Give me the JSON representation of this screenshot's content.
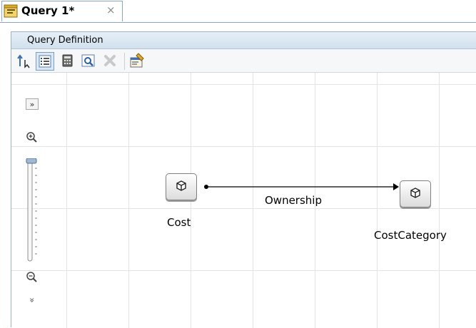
{
  "tab": {
    "title": "Query  1*",
    "close_glyph": "×"
  },
  "panel": {
    "title": "Query Definition"
  },
  "toolbar": {
    "buttons": [
      {
        "name": "move-up-icon"
      },
      {
        "name": "list-view-icon",
        "active": true
      },
      {
        "name": "calculator-icon"
      },
      {
        "name": "find-icon"
      },
      {
        "name": "delete-icon",
        "disabled": true
      },
      {
        "name": "properties-icon"
      }
    ]
  },
  "diagram": {
    "nodes": [
      {
        "id": "cost",
        "label": "Cost"
      },
      {
        "id": "costcategory",
        "label": "CostCategory"
      }
    ],
    "edges": [
      {
        "from": "cost",
        "to": "costcategory",
        "label": "Ownership"
      }
    ]
  },
  "zoom_controls": {
    "expand_glyph": "»",
    "collapse_glyph": "»",
    "level": 1.0
  },
  "colors": {
    "panel_header": "#d8e5f2",
    "grid": "#e3e3e3",
    "border": "#9bb3c9"
  }
}
